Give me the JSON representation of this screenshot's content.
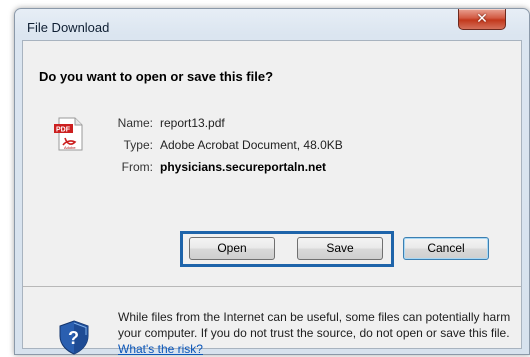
{
  "window": {
    "title": "File Download",
    "close_glyph": "✕"
  },
  "dialog": {
    "question": "Do you want to open or save this file?",
    "file_icon": "pdf-file-icon",
    "fields": {
      "name_label": "Name:",
      "name_value": "report13.pdf",
      "type_label": "Type:",
      "type_value": "Adobe Acrobat Document, 48.0KB",
      "from_label": "From:",
      "from_value": "physicians.secureportaln.net"
    },
    "buttons": {
      "open": "Open",
      "save": "Save",
      "cancel": "Cancel"
    },
    "highlight_color": "#1e64aa"
  },
  "warning": {
    "icon": "shield-question-icon",
    "text": "While files from the Internet can be useful, some files can potentially harm your computer. If you do not trust the source, do not open or save this file.",
    "link": "What's the risk?"
  }
}
